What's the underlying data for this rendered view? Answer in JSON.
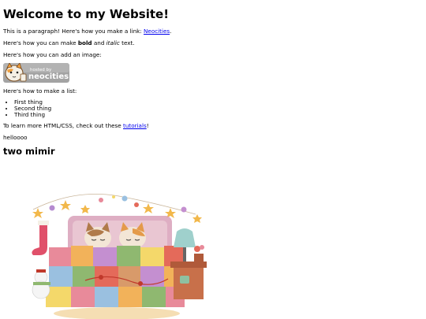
{
  "page": {
    "heading": "Welcome to my Website!",
    "p1": {
      "text": "This is a paragraph! Here's how you make a link: ",
      "link": "Neocities",
      "after": "."
    },
    "p2": {
      "before": "Here's how you can make ",
      "bold": "bold",
      "middle": " and ",
      "italic": "italic",
      "after": " text."
    },
    "p3": "Here's how you can add an image:",
    "badge": {
      "line1": "hosted by",
      "line2": "neocities"
    },
    "p4": "Here's how to make a list:",
    "list": [
      "First thing",
      "Second thing",
      "Third thing"
    ],
    "p5": {
      "before": "To learn more HTML/CSS, check out these ",
      "link": "tutorials",
      "after": "!"
    },
    "p6": "helloooo",
    "subheading": "two mimir"
  },
  "colors": {
    "link": "#0000ee",
    "badge_bg": "#9a9a9a",
    "quilt": [
      "#e88a9a",
      "#f2b25a",
      "#8fb870",
      "#c48fd0",
      "#f4d86a",
      "#e46a5a",
      "#9ac0e0",
      "#d89a6a"
    ]
  },
  "icons": [
    "neocities-cat-icon",
    "star-icon"
  ]
}
